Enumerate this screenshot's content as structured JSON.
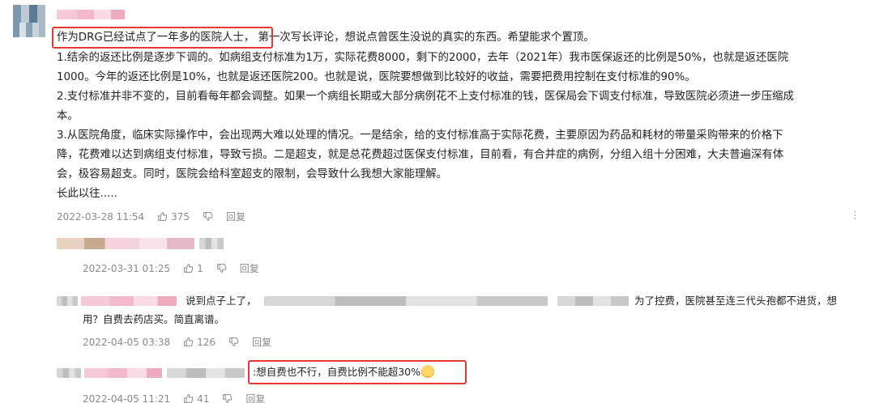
{
  "main_comment": {
    "highlight": "作为DRG已经试点了一年多的医院人士，",
    "lines": [
      "第一次写长评论，想说点曾医生没说的真实的东西。希望能求个置顶。",
      "1.结余的返还比例是逐步下调的。如病组支付标准为1万，实际花费8000，剩下的2000，去年（2021年）我市医保返还的比例是50%，也就是返还医院",
      "1000。今年的返还比例是10%，也就是返还医院200。也就是说，医院要想做到比较好的收益，需要把费用控制在支付标准的90%。",
      "2.支付标准并非不变的，目前看每年都会调整。如果一个病组长期或大部分病例花不上支付标准的钱，医保局会下调支付标准，导致医院必须进一步压缩成",
      "本。",
      "3.从医院角度，临床实际操作中，会出现两大难以处理的情况。一是结余，给的支付标准高于实际花费，主要原因为药品和耗材的带量采购带来的价格下",
      "降，花费难以达到病组支付标准，导致亏损。二是超支，就是总花费超过医保支付标准，目前看，有合并症的病例，分组入组十分困难，大夫普遍深有体",
      "会，极容易超支。同时，医院会给科室超支的限制，会导致什么我想大家能理解。",
      "长此以往....."
    ],
    "date": "2022-03-28 11:54",
    "likes": "375",
    "reply_label": "回复",
    "more": "⋮"
  },
  "replies": [
    {
      "date": "2022-03-31 01:25",
      "likes": "1",
      "reply_label": "回复"
    },
    {
      "prefix": "说到点子上了，",
      "suffix": "为了控费，医院甚至连三代头孢都不进货，想",
      "line2": "用？自费去药店买。简直离谱。",
      "date": "2022-04-05 03:38",
      "likes": "126",
      "reply_label": "回复"
    },
    {
      "text": ":想自费也不行，自费比例不能超30%",
      "date": "2022-04-05 11:21",
      "likes": "41",
      "reply_label": "回复"
    }
  ],
  "colors": {
    "highlight_border": "#e53935",
    "meta_gray": "#8a8a8a"
  }
}
